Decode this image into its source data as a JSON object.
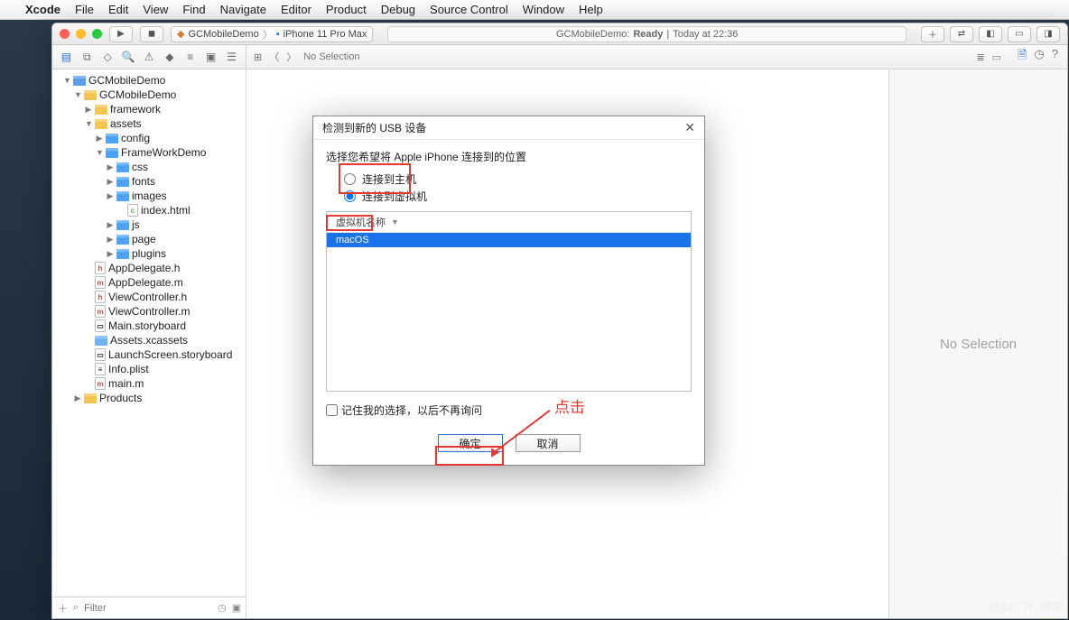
{
  "menubar": {
    "app": "Xcode",
    "items": [
      "File",
      "Edit",
      "View",
      "Find",
      "Navigate",
      "Editor",
      "Product",
      "Debug",
      "Source Control",
      "Window",
      "Help"
    ]
  },
  "toolbar": {
    "scheme": "GCMobileDemo",
    "destination": "iPhone 11 Pro Max",
    "status_prefix": "GCMobileDemo: ",
    "status_ready": "Ready",
    "status_sep": " | ",
    "status_time": "Today at 22:36"
  },
  "subbar": {
    "no_selection": "No Selection"
  },
  "tree": {
    "root": "GCMobileDemo",
    "app": "GCMobileDemo",
    "framework": "framework",
    "assets": "assets",
    "config": "config",
    "frameworkdemo": "FrameWorkDemo",
    "css": "css",
    "fonts": "fonts",
    "images": "images",
    "indexhtml": "index.html",
    "js": "js",
    "page": "page",
    "plugins": "plugins",
    "appdelegateh": "AppDelegate.h",
    "appdelegatem": "AppDelegate.m",
    "viewcontrollerh": "ViewController.h",
    "viewcontrollerm": "ViewController.m",
    "mainsb": "Main.storyboard",
    "assetsx": "Assets.xcassets",
    "launchsb": "LaunchScreen.storyboard",
    "infoplist": "Info.plist",
    "mainm": "main.m",
    "products": "Products"
  },
  "nav": {
    "filter_placeholder": "Filter"
  },
  "inspector": {
    "no_selection": "No Selection"
  },
  "dialog": {
    "title": "检测到新的 USB 设备",
    "prompt": "选择您希望将 Apple iPhone 连接到的位置",
    "radio_host": "连接到主机",
    "radio_vm": "连接到虚拟机",
    "vm_col": "虚拟机名称",
    "vm_item": "macOS",
    "remember": "记住我的选择，以后不再询问",
    "ok": "确定",
    "cancel": "取消"
  },
  "annotation": {
    "click": "点击"
  },
  "watermark": "@51CTO博客"
}
